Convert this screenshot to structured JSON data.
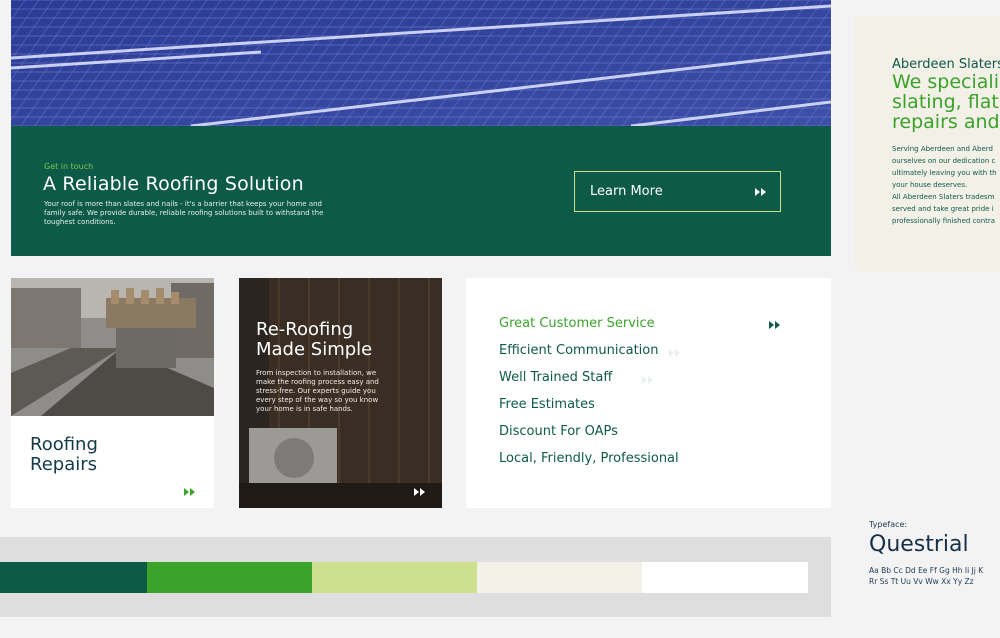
{
  "banner": {
    "eyebrow": "Get in touch",
    "title": "A Reliable Roofing Solution",
    "description": "Your roof is more than slates and nails - it's a barrier that keeps your home and family safe. We provide durable, reliable roofing solutions built to withstand the toughest conditions.",
    "button_label": "Learn More"
  },
  "cards": {
    "roofing_title": "Roofing Repairs",
    "reroof_title": "Re-Roofing Made Simple",
    "reroof_desc": "From inspection to installation, we make the roofing process easy and stress-free. Our experts guide you every step of the way so you know your home is in safe hands."
  },
  "services": [
    "Great Customer Service",
    "Efficient Communication",
    "Well Trained Staff",
    "Free Estimates",
    "Discount For OAPs",
    "Local, Friendly, Professional"
  ],
  "palette": [
    "#0e5a48",
    "#3aa32a",
    "#cde08f",
    "#f3f0e7",
    "#ffffff"
  ],
  "side": {
    "brand": "Aberdeen Slaters",
    "headline_1": "We speciali",
    "headline_2": "slating, flat r",
    "headline_3": "repairs and",
    "para_1": "Serving Aberdeen and Aberd",
    "para_2": "ourselves on our dedication c",
    "para_3": "ultimately leaving you with th",
    "para_4": "your house deserves.",
    "para_5": "All Aberdeen Slaters tradesm",
    "para_6": "served and take great pride i",
    "para_7": "professionally finished contra"
  },
  "typeface": {
    "label": "Typeface:",
    "name": "Questrial",
    "glyphs_1": "Aa Bb Cc Dd Ee Ff Gg Hh Ii Jj K",
    "glyphs_2": "Rr Ss Tt Uu Vv Ww Xx Yy Zz"
  },
  "icons": {
    "arrow": "double-chevron-right-icon"
  }
}
